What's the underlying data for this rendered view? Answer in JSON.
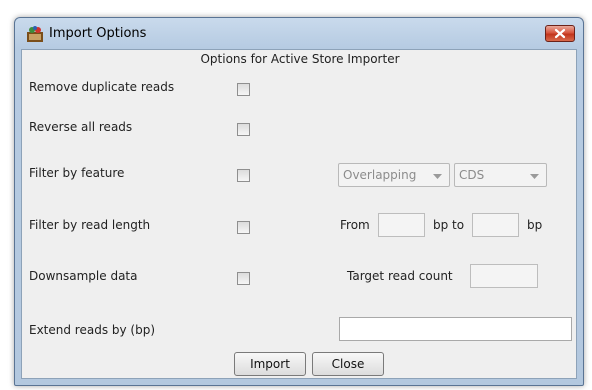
{
  "window": {
    "title": "Import Options"
  },
  "heading": "Options for Active Store Importer",
  "options": {
    "remove_duplicates": "Remove duplicate reads",
    "reverse_reads": "Reverse all reads",
    "filter_feature": "Filter by feature",
    "filter_length": "Filter by read length",
    "downsample": "Downsample data",
    "extend": "Extend reads by (bp)"
  },
  "feature_filter": {
    "mode": "Overlapping",
    "feature_type": "CDS"
  },
  "length_filter": {
    "from_label": "From",
    "to_label": "bp to",
    "unit_label": "bp"
  },
  "downsample_filter": {
    "target_label": "Target read count"
  },
  "buttons": {
    "import": "Import",
    "close": "Close"
  },
  "icons": {
    "app": "app-icon",
    "close": "close-icon",
    "dropdown": "chevron-down-icon"
  }
}
